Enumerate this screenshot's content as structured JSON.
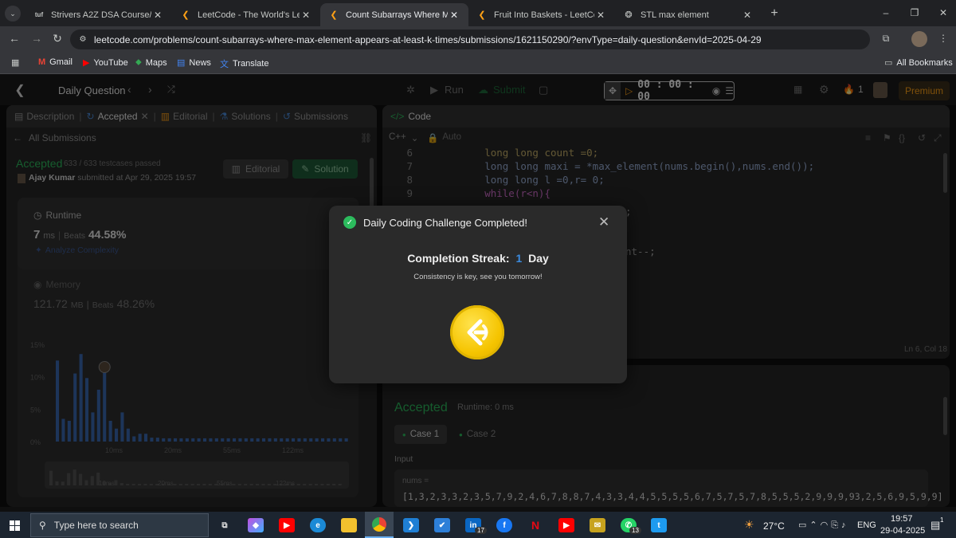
{
  "browser": {
    "tabs": [
      {
        "title": "Strivers A2Z DSA Course/Sheet",
        "fav": "tuf"
      },
      {
        "title": "LeetCode - The World's Leading",
        "fav": "lc"
      },
      {
        "title": "Count Subarrays Where Max Ele",
        "fav": "lc"
      },
      {
        "title": "Fruit Into Baskets - LeetCode",
        "fav": "lc"
      },
      {
        "title": "STL max element",
        "fav": "chatgpt"
      }
    ],
    "url": "leetcode.com/problems/count-subarrays-where-max-element-appears-at-least-k-times/submissions/1621150290/?envType=daily-question&envId=2025-04-29",
    "bookmarks": [
      "Gmail",
      "YouTube",
      "Maps",
      "News",
      "Translate"
    ],
    "all_bookmarks": "All Bookmarks"
  },
  "header": {
    "title": "Daily Question",
    "run": "Run",
    "submit": "Submit",
    "timer": "00 : 00 : 00",
    "streak": "1",
    "premium": "Premium"
  },
  "left": {
    "tabs": [
      "Description",
      "Accepted",
      "Editorial",
      "Solutions",
      "Submissions"
    ],
    "all_submissions": "All Submissions",
    "accepted": "Accepted",
    "testcases": "633 / 633 testcases passed",
    "user": "Ajay Kumar",
    "submitted": "submitted at Apr 29, 2025 19:57",
    "editorial_btn": "Editorial",
    "solution_btn": "Solution",
    "runtime_label": "Runtime",
    "runtime_value": "7",
    "runtime_unit": "ms",
    "beats_label": "Beats",
    "runtime_beats": "44.58%",
    "analyze": "Analyze Complexity",
    "memory_label": "Memory",
    "memory_value": "121.72",
    "memory_unit": "MB",
    "memory_beats": "48.26%"
  },
  "chart_data": {
    "type": "bar",
    "ylabel_ticks": [
      "15%",
      "10%",
      "5%",
      "0%"
    ],
    "x_ticks": [
      "10ms",
      "20ms",
      "55ms",
      "122ms"
    ],
    "ylim": [
      0,
      15
    ],
    "values": [
      12.5,
      3.5,
      3.2,
      10.5,
      13.5,
      9.8,
      4.5,
      8.0,
      11.0,
      3.2,
      2.0,
      4.5,
      2.0,
      0.8,
      1.2,
      1.2,
      0.6,
      0.6,
      0.5,
      0.5,
      0.5,
      0.5,
      0.5,
      0.5,
      0.5,
      0.5,
      0.5,
      0.5,
      0.5,
      0.5,
      0.5,
      0.5,
      0.5,
      0.5,
      0.5,
      0.5,
      0.5,
      0.5,
      0.5,
      0.5,
      0.5,
      0.5,
      0.5,
      0.5,
      0.5,
      0.5,
      0.5,
      0.5,
      0.5,
      0.5
    ],
    "highlight_index": 8,
    "color": "#3b6bb5"
  },
  "code": {
    "title": "Code",
    "lang": "C++",
    "mode": "Auto",
    "lines": [
      {
        "n": "6",
        "t": "        long long count =0;"
      },
      {
        "n": "7",
        "t": "        long long maxi = *max_element(nums.begin(),nums.end());"
      },
      {
        "n": "8",
        "t": "        long long l =0,r= 0;"
      },
      {
        "n": "9",
        "t": "        while(r<n){"
      }
    ],
    "partial1": ";",
    "partial2": "nt--;",
    "status": "Ln 6, Col 18"
  },
  "result": {
    "accepted": "Accepted",
    "runtime": "Runtime: 0 ms",
    "case1": "Case 1",
    "case2": "Case 2",
    "input": "Input",
    "nums_label": "nums =",
    "nums": "[1,3,2,3,3,2,3,5,7,9,2,4,6,7,8,8,7,4,3,3,4,4,5,5,5,5,6,7,5,7,5,7,8,5,5,5,2,9,9,9,93,2,5,6,9,5,9,9]"
  },
  "modal": {
    "title": "Daily Coding Challenge Completed!",
    "streak_label": "Completion Streak:",
    "streak_num": "1",
    "streak_unit": "Day",
    "subtitle": "Consistency is key, see you tomorrow!"
  },
  "taskbar": {
    "search": "Type here to search",
    "temp": "27°C",
    "lang": "ENG",
    "time": "19:57",
    "date": "29-04-2025",
    "badge_linkedin": "17",
    "badge_whatsapp": "13",
    "badge_notif": "1"
  }
}
